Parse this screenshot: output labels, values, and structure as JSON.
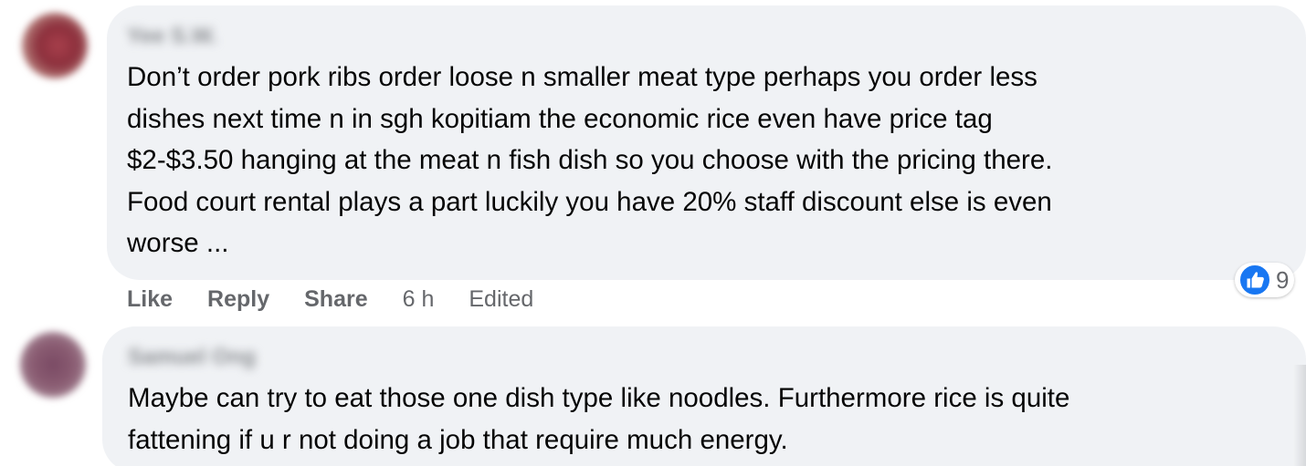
{
  "comments": [
    {
      "author": "Yee S.W.",
      "text": "Don’t order pork ribs order loose n smaller meat type perhaps you order less\ndishes next time n in sgh kopitiam the economic rice even have price tag\n$2-$3.50 hanging at the meat n fish dish so you choose with the pricing there.\nFood court rental plays a part luckily you have 20% staff discount else is even\nworse ...",
      "actions": {
        "like": "Like",
        "reply": "Reply",
        "share": "Share",
        "time": "6 h",
        "edited": "Edited"
      },
      "reaction": {
        "icon": "thumbs-up-icon",
        "count": "9",
        "color": "#1877f2"
      }
    },
    {
      "author": "Samuel Ong",
      "text": "Maybe can try to eat those one dish type like noodles. Furthermore rice is quite\nfattening if u r not doing a job that require much energy."
    }
  ]
}
